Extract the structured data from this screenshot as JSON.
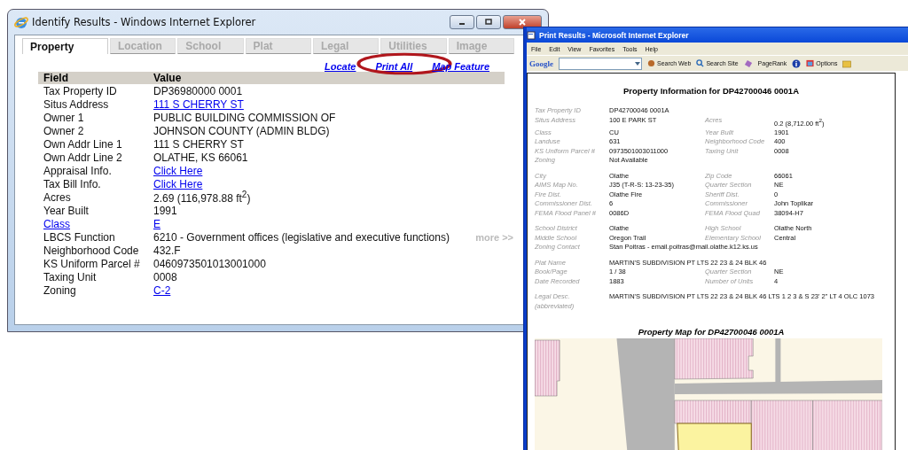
{
  "identify_window": {
    "title": "Identify Results - Windows Internet Explorer",
    "tabs": [
      {
        "label": "Property",
        "selected": true
      },
      {
        "label": "Location",
        "selected": false
      },
      {
        "label": "School",
        "selected": false
      },
      {
        "label": "Plat",
        "selected": false
      },
      {
        "label": "Legal",
        "selected": false
      },
      {
        "label": "Utilities",
        "selected": false
      },
      {
        "label": "Image",
        "selected": false
      }
    ],
    "links": [
      {
        "label": "Locate",
        "circled": false
      },
      {
        "label": "Print All",
        "circled": true
      },
      {
        "label": "Map Feature",
        "circled": false
      }
    ],
    "table": {
      "columns": [
        "Field",
        "Value"
      ],
      "rows": [
        {
          "field": "Tax Property ID",
          "value": "DP36980000 0001",
          "field_link": false,
          "value_link": false
        },
        {
          "field": "Situs Address",
          "value": "111 S CHERRY ST",
          "field_link": false,
          "value_link": true
        },
        {
          "field": "Owner 1",
          "value": "PUBLIC BUILDING COMMISSION OF",
          "field_link": false,
          "value_link": false
        },
        {
          "field": "Owner 2",
          "value": "JOHNSON COUNTY (ADMIN BLDG)",
          "field_link": false,
          "value_link": false
        },
        {
          "field": "Own Addr Line 1",
          "value": "111 S CHERRY ST",
          "field_link": false,
          "value_link": false
        },
        {
          "field": "Own Addr Line 2",
          "value": "OLATHE, KS 66061",
          "field_link": false,
          "value_link": false
        },
        {
          "field": "Appraisal Info.",
          "value": "Click Here",
          "field_link": false,
          "value_link": true
        },
        {
          "field": "Tax Bill Info.",
          "value": "Click Here",
          "field_link": false,
          "value_link": true
        },
        {
          "field": "Acres",
          "value": "2.69 (116,978.88 ft$^{2}$)",
          "field_link": false,
          "value_link": false
        },
        {
          "field": "Year Built",
          "value": "1991",
          "field_link": false,
          "value_link": false
        },
        {
          "field": "Class",
          "value": "E",
          "field_link": true,
          "value_link": true
        },
        {
          "field": "LBCS Function",
          "value": "6210 - Government offices (legislative and executive functions)",
          "field_link": false,
          "value_link": false,
          "more": "more >>"
        },
        {
          "field": "Neighborhood Code",
          "value": "432.F",
          "field_link": false,
          "value_link": false
        },
        {
          "field": "KS Uniform Parcel #",
          "value": "0460973501013001000",
          "field_link": false,
          "value_link": false
        },
        {
          "field": "Taxing Unit",
          "value": "0008",
          "field_link": false,
          "value_link": false
        },
        {
          "field": "Zoning",
          "value": "C-2",
          "field_link": false,
          "value_link": true
        }
      ]
    }
  },
  "print_window": {
    "title": "Print Results - Microsoft Internet Explorer",
    "menu": [
      "File",
      "Edit",
      "View",
      "Favorites",
      "Tools",
      "Help"
    ],
    "toolbar": {
      "logo": "Google",
      "search_web": "Search Web",
      "search_site": "Search Site",
      "pagerank": "PageRank",
      "options": "Options"
    },
    "page_title": "Property Information for DP42700046 0001A",
    "sections": [
      [
        [
          {
            "label": "Tax Property ID",
            "value": "DP42700046 0001A"
          }
        ],
        [
          {
            "label": "Situs Address",
            "value": "100 E PARK ST"
          },
          {
            "label": "Acres",
            "value": "0.2 (8,712.00 ft$^{2}$)"
          }
        ],
        [
          {
            "label": "Class",
            "value": "CU"
          },
          {
            "label": "Year Built",
            "value": "1901"
          }
        ],
        [
          {
            "label": "Landuse",
            "value": "631"
          },
          {
            "label": "Neighborhood Code",
            "value": "400"
          }
        ],
        [
          {
            "label": "KS Uniform Parcel #",
            "value": "0973501003011000"
          },
          {
            "label": "Taxing Unit",
            "value": "0008"
          }
        ],
        [
          {
            "label": "Zoning",
            "value": "Not Available"
          }
        ]
      ],
      [
        [
          {
            "label": "City",
            "value": "Olathe"
          },
          {
            "label": "Zip Code",
            "value": "66061"
          }
        ],
        [
          {
            "label": "AIMS Map No.",
            "value": "J35  (T-R-S: 13-23-35)"
          },
          {
            "label": "Quarter Section",
            "value": "NE"
          }
        ],
        [
          {
            "label": "Fire Dist.",
            "value": "Olathe Fire"
          },
          {
            "label": "Sheriff Dist.",
            "value": "0"
          }
        ],
        [
          {
            "label": "Commissioner Dist.",
            "value": "6"
          },
          {
            "label": "Commissioner",
            "value": "John Toplikar"
          }
        ],
        [
          {
            "label": "FEMA Flood Panel #",
            "value": "0086D"
          },
          {
            "label": "FEMA Flood Quad",
            "value": "38094-H7"
          }
        ]
      ],
      [
        [
          {
            "label": "School District",
            "value": "Olathe"
          },
          {
            "label": "High School",
            "value": "Olathe North"
          }
        ],
        [
          {
            "label": "Middle School",
            "value": "Oregon Trail"
          },
          {
            "label": "Elementary School",
            "value": "Central"
          }
        ],
        [
          {
            "label": "Zoning Contact",
            "value": "Stan Poitras - email.poitras@mail.olathe.k12.ks.us"
          }
        ]
      ],
      [
        [
          {
            "label": "Plat Name",
            "value": "MARTIN'S SUBDIVISION PT LTS 22 23 & 24 BLK 46"
          }
        ],
        [
          {
            "label": "Book/Page",
            "value": "1 / 38"
          },
          {
            "label": "Quarter Section",
            "value": "NE"
          }
        ],
        [
          {
            "label": "Date Recorded",
            "value": "1883"
          },
          {
            "label": "Number of Units",
            "value": "4"
          }
        ]
      ],
      [
        [
          {
            "label": "Legal Desc.",
            "sublabel": "(abbreviated)",
            "value": "MARTIN'S SUBDIVISION PT LTS 22 23 & 24 BLK 46 LTS 1 2 3 & S 23' 2\" LT 4 OLC 1073"
          }
        ]
      ]
    ],
    "map_title": "Property Map for DP42700046 0001A"
  }
}
